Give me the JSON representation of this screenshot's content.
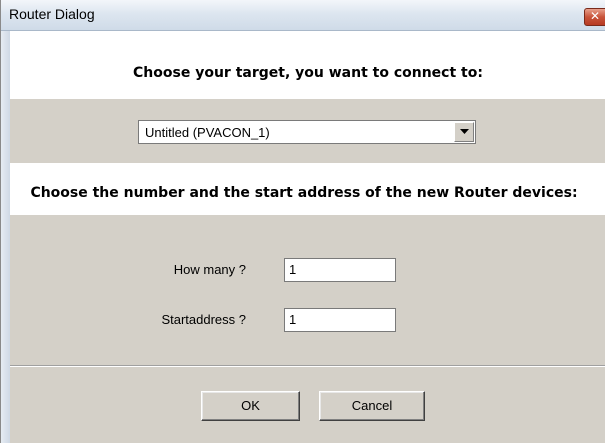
{
  "window": {
    "title": "Router Dialog",
    "close_glyph": "✕"
  },
  "target_section": {
    "heading": "Choose your target, you want to connect to:",
    "selected_target": "Untitled (PVACON_1)"
  },
  "devices_section": {
    "heading": "Choose the number and the start address of the new Router devices:",
    "how_many_label": "How many ?",
    "how_many_value": "1",
    "startaddress_label": "Startaddress ?",
    "startaddress_value": "1"
  },
  "buttons": {
    "ok_label": "OK",
    "cancel_label": "Cancel"
  },
  "colors": {
    "dialog_gray": "#d4d0c8",
    "close_button_red": "#c8543a"
  },
  "icons": {
    "dropdown": "chevron-down-icon",
    "close": "close-icon"
  }
}
